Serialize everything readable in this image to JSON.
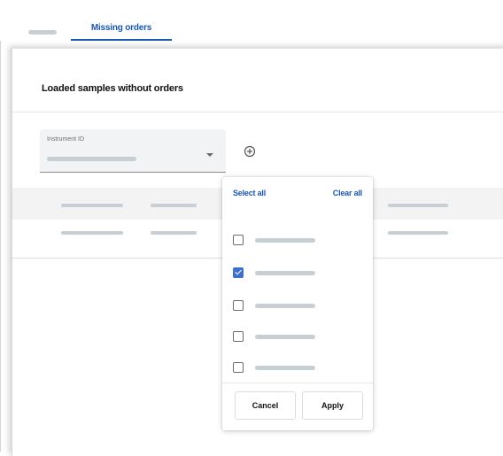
{
  "tabs": {
    "active_label": "Missing orders"
  },
  "panel": {
    "title": "Loaded samples without orders"
  },
  "instrument_field": {
    "label": "Instrument ID"
  },
  "filter_popup": {
    "select_all_label": "Select all",
    "clear_all_label": "Clear all",
    "options": [
      {
        "checked": false
      },
      {
        "checked": true
      },
      {
        "checked": false
      },
      {
        "checked": false
      },
      {
        "checked": false
      }
    ],
    "cancel_label": "Cancel",
    "apply_label": "Apply"
  },
  "colors": {
    "accent": "#1a56b3",
    "checkbox_checked": "#3b6fd0",
    "placeholder_bar": "#c7cfd2"
  },
  "icons": {
    "add_filter": "plus-circle-icon",
    "dropdown": "chevron-down-icon",
    "checkbox": "checkbox-icon"
  }
}
